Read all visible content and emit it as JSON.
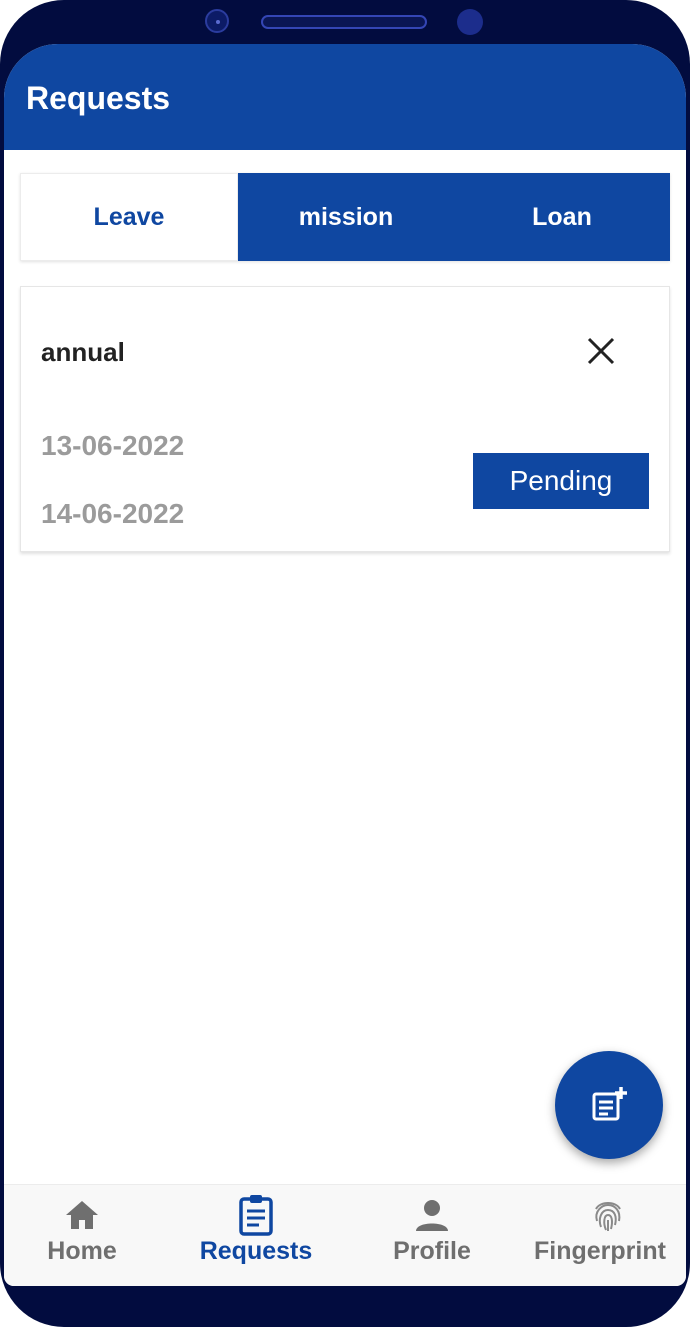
{
  "app": {
    "title": "Requests"
  },
  "tabs": [
    {
      "label": "Leave",
      "active": true
    },
    {
      "label": "mission",
      "active": false
    },
    {
      "label": "Loan",
      "active": false
    }
  ],
  "requests": [
    {
      "type": "annual",
      "from_date": "13-06-2022",
      "to_date": "14-06-2022",
      "status": "Pending"
    }
  ],
  "fab": {
    "icon": "add-note-icon"
  },
  "bottom_nav": [
    {
      "label": "Home",
      "icon": "home-icon",
      "active": false
    },
    {
      "label": "Requests",
      "icon": "clipboard-icon",
      "active": true
    },
    {
      "label": "Profile",
      "icon": "person-icon",
      "active": false
    },
    {
      "label": "Fingerprint",
      "icon": "fingerprint-icon",
      "active": false
    }
  ],
  "colors": {
    "primary": "#0f47a1",
    "frame": "#020c3f",
    "muted_text": "#9b9b9b",
    "inactive_nav": "#6f6f6f"
  }
}
